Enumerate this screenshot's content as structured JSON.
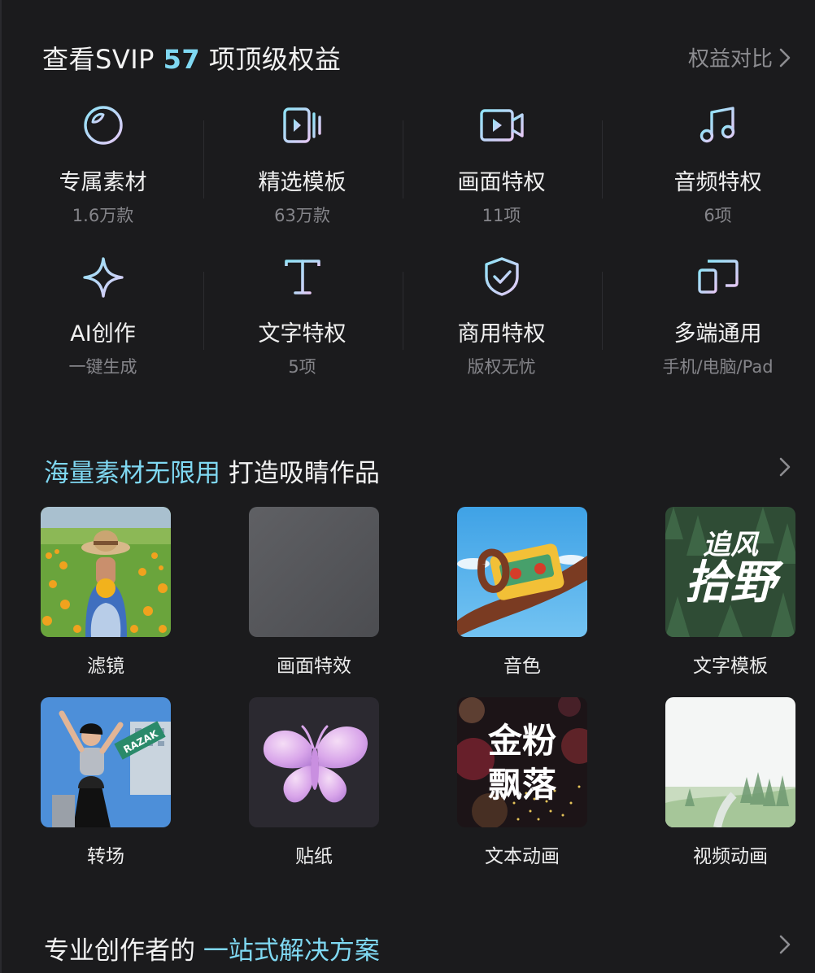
{
  "header": {
    "title_prefix": "查看SVIP ",
    "title_count": "57",
    "title_suffix": " 项顶级权益",
    "compare_label": "权益对比"
  },
  "benefits": [
    {
      "name": "专属素材",
      "desc": "1.6万款",
      "icon": "palette-icon"
    },
    {
      "name": "精选模板",
      "desc": "63万款",
      "icon": "template-icon"
    },
    {
      "name": "画面特权",
      "desc": "11项",
      "icon": "video-camera-icon"
    },
    {
      "name": "音频特权",
      "desc": "6项",
      "icon": "music-note-icon"
    },
    {
      "name": "AI创作",
      "desc": "一键生成",
      "icon": "sparkle-icon"
    },
    {
      "name": "文字特权",
      "desc": "5项",
      "icon": "text-icon"
    },
    {
      "name": "商用特权",
      "desc": "版权无忧",
      "icon": "shield-check-icon"
    },
    {
      "name": "多端通用",
      "desc": "手机/电脑/Pad",
      "icon": "multi-device-icon"
    }
  ],
  "materials_section": {
    "highlight": "海量素材无限用",
    "rest": " 打造吸睛作品"
  },
  "materials": [
    {
      "label": "滤镜"
    },
    {
      "label": "画面特效"
    },
    {
      "label": "音色"
    },
    {
      "label": "文字模板",
      "thumb_line1": "追风",
      "thumb_line2": "拾野"
    },
    {
      "label": "转场",
      "thumb_sign": "RAZAK"
    },
    {
      "label": "贴纸"
    },
    {
      "label": "文本动画",
      "thumb_line1": "金粉",
      "thumb_line2": "飘落"
    },
    {
      "label": "视频动画"
    }
  ],
  "pro_section": {
    "normal": "专业创作者的 ",
    "highlight": "一站式解决方案"
  },
  "colors": {
    "accent": "#7fd8f2",
    "background": "#1b1b1d",
    "muted_text": "#85858a"
  }
}
